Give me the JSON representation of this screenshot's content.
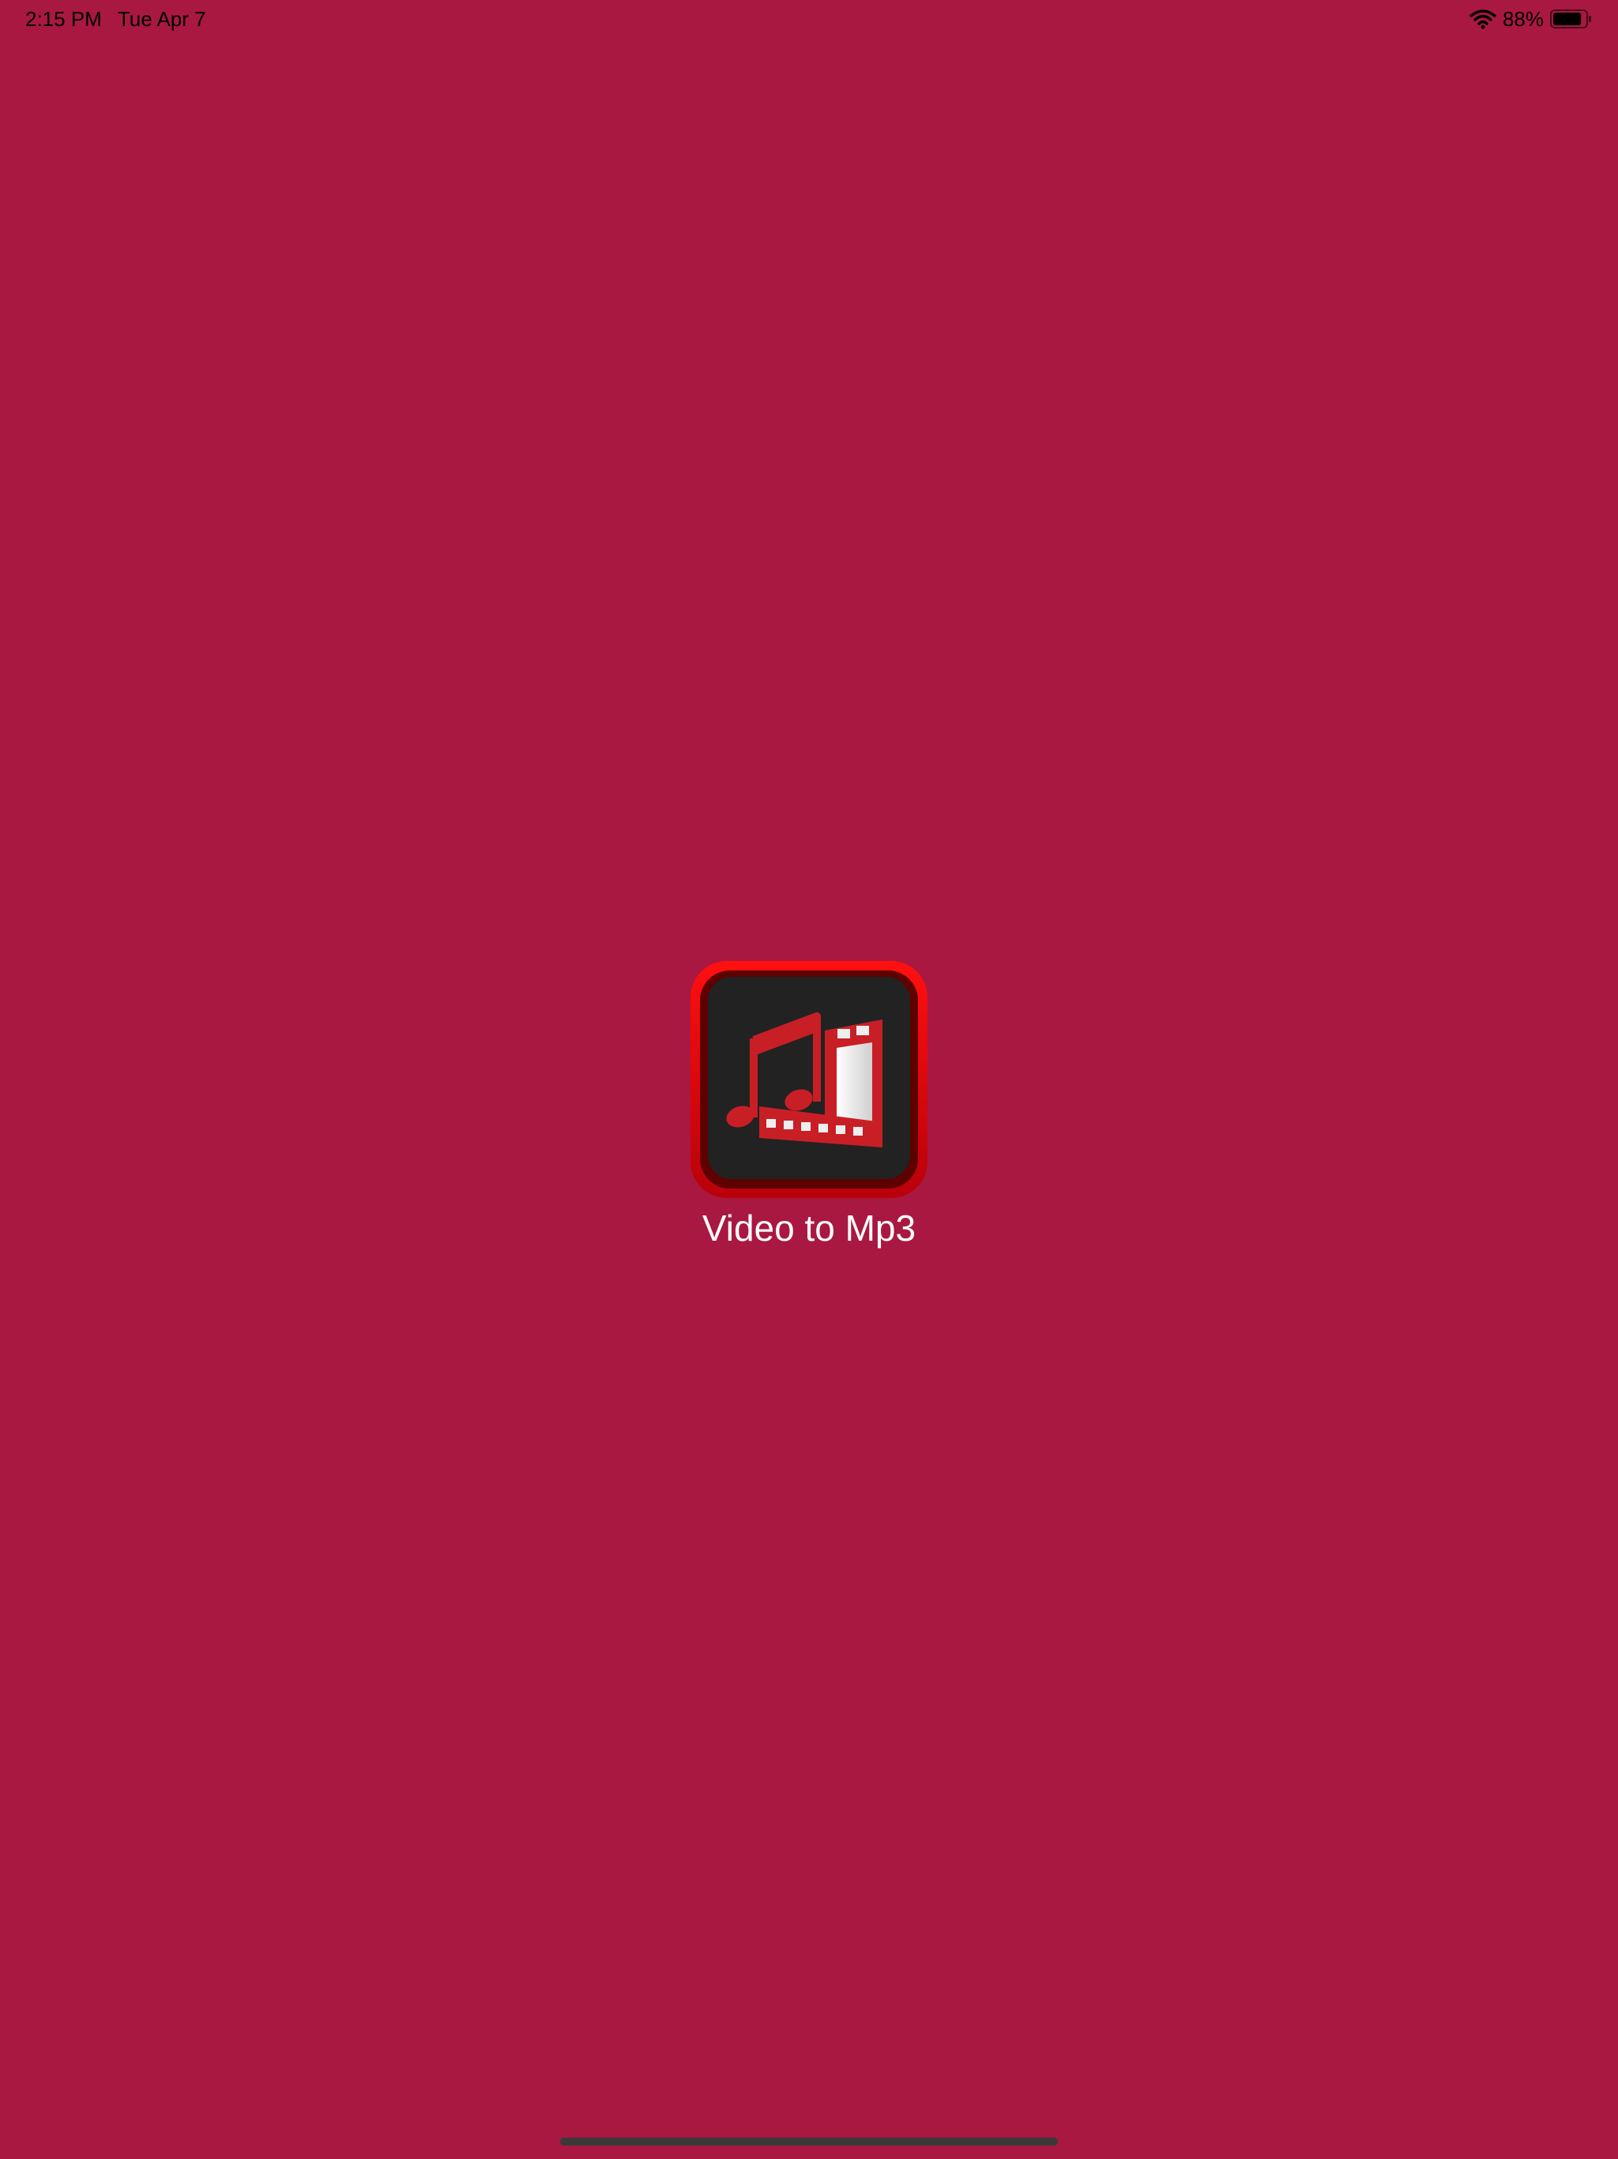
{
  "status_bar": {
    "time": "2:15 PM",
    "date": "Tue Apr 7",
    "battery_percent": "88%",
    "battery_level": 0.88,
    "icons": [
      "wifi-icon",
      "battery-icon"
    ]
  },
  "splash": {
    "app_name": "Video to Mp3",
    "icon": "app-logo-music-film-icon"
  },
  "colors": {
    "background": "#a91840",
    "icon_frame": "#d8000c",
    "icon_inner": "#222222",
    "label": "#ffffff"
  }
}
